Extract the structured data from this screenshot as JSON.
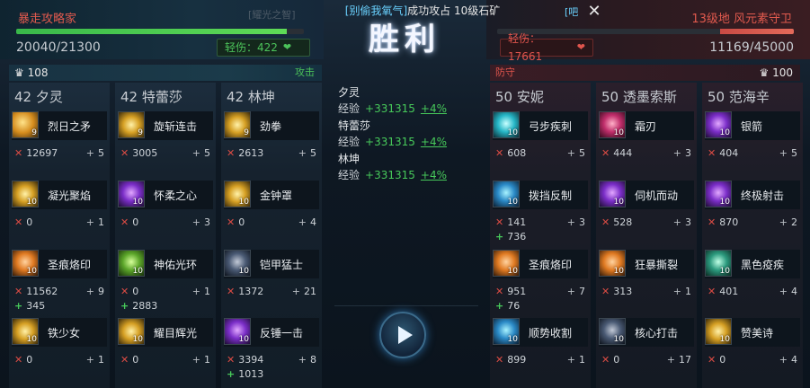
{
  "header": {
    "chat_prefix": "[别偷我氧气]",
    "chat_message": "成功攻占 10级石矿",
    "chat_tag": "[吧",
    "victory_text": "胜利",
    "ghost_badge": "[耀光之智]"
  },
  "ally_team": {
    "name": "暴走攻略家",
    "hp_current": "20040",
    "hp_total": "/21300",
    "hp_fraction": 0.94,
    "minor_injury": "轻伤：422",
    "hero_count": "108",
    "role": "攻击"
  },
  "enemy_team": {
    "name": "13级地 风元素守卫",
    "hp_current": "11169",
    "hp_total": "/45000",
    "hp_fraction": 0.25,
    "minor_injury": "轻伤：17661",
    "hero_count": "100",
    "role": "防守"
  },
  "heroes": [
    {
      "title": "42 夕灵",
      "skills": [
        {
          "name": "烈日之矛",
          "level": "9",
          "kills": "12697",
          "assists": "5",
          "heal": ""
        },
        {
          "name": "凝光聚焰",
          "level": "10",
          "kills": "0",
          "assists": "1",
          "heal": ""
        },
        {
          "name": "圣痕烙印",
          "level": "10",
          "kills": "11562",
          "assists": "9",
          "heal": "345"
        },
        {
          "name": "铁少女",
          "level": "10",
          "kills": "0",
          "assists": "1",
          "heal": ""
        }
      ]
    },
    {
      "title": "42 特蕾莎",
      "skills": [
        {
          "name": "旋斩连击",
          "level": "9",
          "kills": "3005",
          "assists": "5",
          "heal": ""
        },
        {
          "name": "怀柔之心",
          "level": "10",
          "kills": "0",
          "assists": "3",
          "heal": ""
        },
        {
          "name": "神佑光环",
          "level": "10",
          "kills": "0",
          "assists": "1",
          "heal": "2883"
        },
        {
          "name": "耀目辉光",
          "level": "10",
          "kills": "0",
          "assists": "1",
          "heal": ""
        }
      ]
    },
    {
      "title": "42 林坤",
      "skills": [
        {
          "name": "劲拳",
          "level": "9",
          "kills": "2613",
          "assists": "5",
          "heal": ""
        },
        {
          "name": "金钟罩",
          "level": "10",
          "kills": "0",
          "assists": "4",
          "heal": ""
        },
        {
          "name": "铠甲猛士",
          "level": "10",
          "kills": "1372",
          "assists": "21",
          "heal": ""
        },
        {
          "name": "反锤一击",
          "level": "10",
          "kills": "3394",
          "assists": "8",
          "heal": "1013"
        }
      ]
    },
    {
      "title": "50 安妮",
      "skills": [
        {
          "name": "弓步疾刺",
          "level": "10",
          "kills": "608",
          "assists": "5",
          "heal": ""
        },
        {
          "name": "拨挡反制",
          "level": "10",
          "kills": "141",
          "assists": "3",
          "heal": "736"
        },
        {
          "name": "圣痕烙印",
          "level": "10",
          "kills": "951",
          "assists": "7",
          "heal": "76"
        },
        {
          "name": "顺势收割",
          "level": "10",
          "kills": "899",
          "assists": "1",
          "heal": ""
        }
      ]
    },
    {
      "title": "50 透墨索斯",
      "skills": [
        {
          "name": "霜刃",
          "level": "10",
          "kills": "444",
          "assists": "3",
          "heal": ""
        },
        {
          "name": "伺机而动",
          "level": "10",
          "kills": "528",
          "assists": "3",
          "heal": ""
        },
        {
          "name": "狂暴撕裂",
          "level": "10",
          "kills": "313",
          "assists": "1",
          "heal": ""
        },
        {
          "name": "核心打击",
          "level": "10",
          "kills": "0",
          "assists": "17",
          "heal": ""
        }
      ]
    },
    {
      "title": "50 范海辛",
      "skills": [
        {
          "name": "银箭",
          "level": "10",
          "kills": "404",
          "assists": "5",
          "heal": ""
        },
        {
          "name": "终极射击",
          "level": "10",
          "kills": "870",
          "assists": "2",
          "heal": ""
        },
        {
          "name": "黑色疫疾",
          "level": "10",
          "kills": "401",
          "assists": "4",
          "heal": ""
        },
        {
          "name": "赞美诗",
          "level": "10",
          "kills": "0",
          "assists": "4",
          "heal": ""
        }
      ]
    }
  ],
  "experience": {
    "label": "经验",
    "entries": [
      {
        "hero": "夕灵",
        "value": "+331315",
        "percent": "+4%"
      },
      {
        "hero": "特蕾莎",
        "value": "+331315",
        "percent": "+4%"
      },
      {
        "hero": "林坤",
        "value": "+331315",
        "percent": "+4%"
      }
    ]
  },
  "icons": {
    "kill": "x-mark-icon",
    "assist": "plus-icon",
    "heal": "heal-plus-icon",
    "play": "play-icon",
    "close": "close-icon",
    "heart": "broken-heart-icon",
    "hero_count": "trophy-icon"
  },
  "colors": {
    "ally_hp": "#5fdc57",
    "enemy_hp": "#e46a5a",
    "kill": "#d94b44",
    "heal": "#47c95a",
    "ally_name": "#e25a4e"
  }
}
